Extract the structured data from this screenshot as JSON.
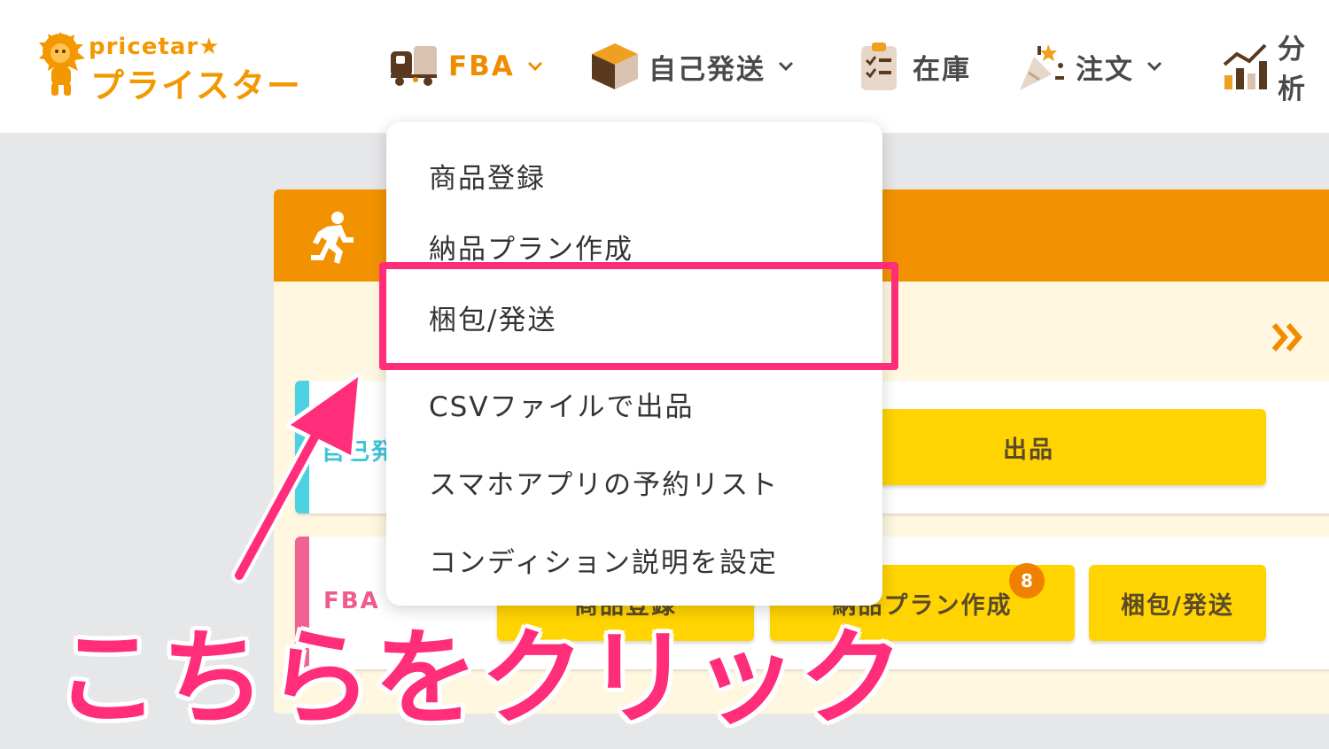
{
  "brand": {
    "logo_en": "pricetar★",
    "logo_jp": "プライスター",
    "primary_color": "#f39800",
    "accent_pink": "#ff2d7a"
  },
  "nav": {
    "items": [
      {
        "label": "FBA",
        "icon": "delivery-truck-icon",
        "has_dropdown": true,
        "active": true
      },
      {
        "label": "自己発送",
        "icon": "package-box-icon",
        "has_dropdown": true
      },
      {
        "label": "在庫",
        "icon": "clipboard-checklist-icon",
        "has_dropdown": false
      },
      {
        "label": "注文",
        "icon": "party-popper-icon",
        "has_dropdown": true
      },
      {
        "label": "分析",
        "icon": "bar-chart-icon",
        "has_dropdown": false
      }
    ]
  },
  "dropdown": {
    "items": [
      "商品登録",
      "納品プラン作成",
      "梱包/発送",
      "CSVファイルで出品",
      "スマホアプリの予約リスト",
      "コンディション説明を設定"
    ],
    "highlighted_item": "梱包/発送"
  },
  "panel": {
    "header_icon": "running-person-icon",
    "next_icon": "double-chevron-right-icon",
    "self_ship_row": {
      "title": "自己発送",
      "buttons": [
        "出品"
      ]
    },
    "fba_row": {
      "title": "FBA",
      "buttons": [
        {
          "label": "商品登録"
        },
        {
          "label": "納品プラン作成",
          "badge": "8"
        },
        {
          "label": "梱包/発送"
        }
      ]
    }
  },
  "annotation": {
    "callout_text": "こちらをクリック"
  }
}
